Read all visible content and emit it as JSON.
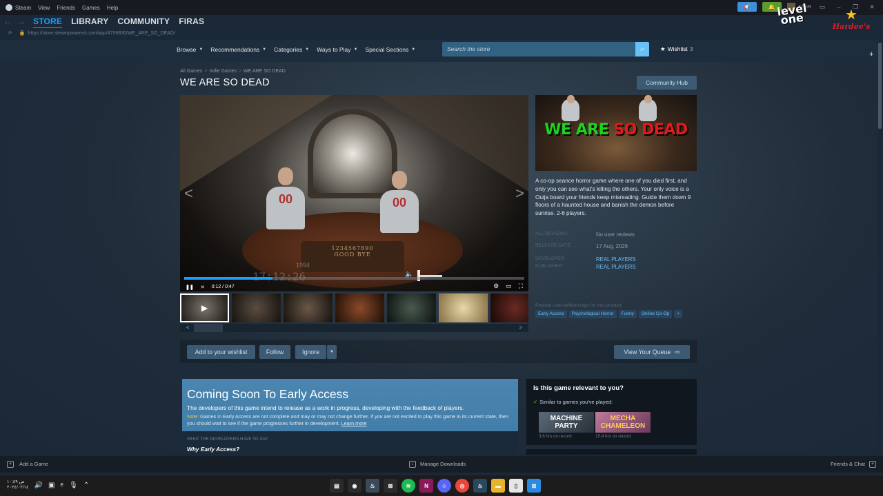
{
  "titlebar": {
    "menu": [
      "Steam",
      "View",
      "Friends",
      "Games",
      "Help"
    ],
    "user_status": "47 SR"
  },
  "overlays": {
    "levelone_line1": "level",
    "levelone_line2": "one",
    "hardees": "Hardee's"
  },
  "nav": {
    "tabs": [
      "STORE",
      "LIBRARY",
      "COMMUNITY",
      "FIRAS"
    ],
    "url": "https://store.steampowered.com/app/4796830/WE_ARE_SO_DEAD/"
  },
  "storenav": {
    "items": [
      "Browse",
      "Recommendations",
      "Categories",
      "Ways to Play",
      "Special Sections"
    ],
    "search_placeholder": "Search the store",
    "wishlist_label": "Wishlist",
    "wishlist_count": "3"
  },
  "breadcrumb": [
    "All Games",
    "Indie Games",
    "WE ARE SO DEAD"
  ],
  "game": {
    "title": "WE ARE SO DEAD",
    "community_hub": "Community Hub",
    "capsule_word1": "WE ARE",
    "capsule_word2": "SO DEAD",
    "description": "A co-op seance horror game where one of you died first, and only you can see what's killing the others. Your only voice is a Ouija board your friends keep misreading. Guide them down 9 floors of a haunted house and banish the demon before sunrise. 2-6 players.",
    "reviews_label": "ALL REVIEWS:",
    "reviews_value": "No user reviews",
    "release_label": "RELEASE DATE:",
    "release_value": "17 Aug, 2026",
    "developer_label": "DEVELOPER:",
    "developer_value": "REAL PLAYERS",
    "publisher_label": "PUBLISHER:",
    "publisher_value": "REAL PLAYERS",
    "tags_heading": "Popular user-defined tags for this product:",
    "tags": [
      "Early Access",
      "Psychological Horror",
      "Funny",
      "Online Co-Op",
      "+"
    ]
  },
  "video": {
    "time": "0:12 / 0:47",
    "progress": 0.26,
    "overlay_timecode": "17:12:26",
    "overlay_year": "1994",
    "board_text": "1234567890",
    "board_text2": "GOOD BYE",
    "shirt_number": "00"
  },
  "actions": {
    "wishlist": "Add to your wishlist",
    "follow": "Follow",
    "ignore": "Ignore",
    "queue": "View Your Queue"
  },
  "early_access": {
    "heading": "Coming Soon To Early Access",
    "text": "The developers of this game intend to release as a work in progress, developing with the feedback of players.",
    "note_label": "Note:",
    "note": " Games in Early Access are not complete and may or may not change further. If you are not excited to play this game in its current state, then you should wait to see if the game progresses further in development. ",
    "learn_more": "Learn more",
    "dev_say": "WHAT THE DEVELOPERS HAVE TO SAY:",
    "why": "Why Early Access?"
  },
  "relevance": {
    "question": "Is this game relevant to you?",
    "similar": "Similar to games you've played:",
    "games": [
      {
        "name": "MACHINE PARTY",
        "hours": "3.6 hrs on record"
      },
      {
        "name": "MECHA CHAMELEON",
        "hours": "15.4 hrs on record"
      }
    ]
  },
  "bottombar": {
    "add_game": "Add a Game",
    "downloads": "Manage Downloads",
    "friends": "Friends & Chat"
  },
  "taskbar": {
    "clock_line1": "ص ١٠:٤٩",
    "clock_line2": "٢٠٢٤/٠٢/١٤",
    "lang": "E"
  }
}
